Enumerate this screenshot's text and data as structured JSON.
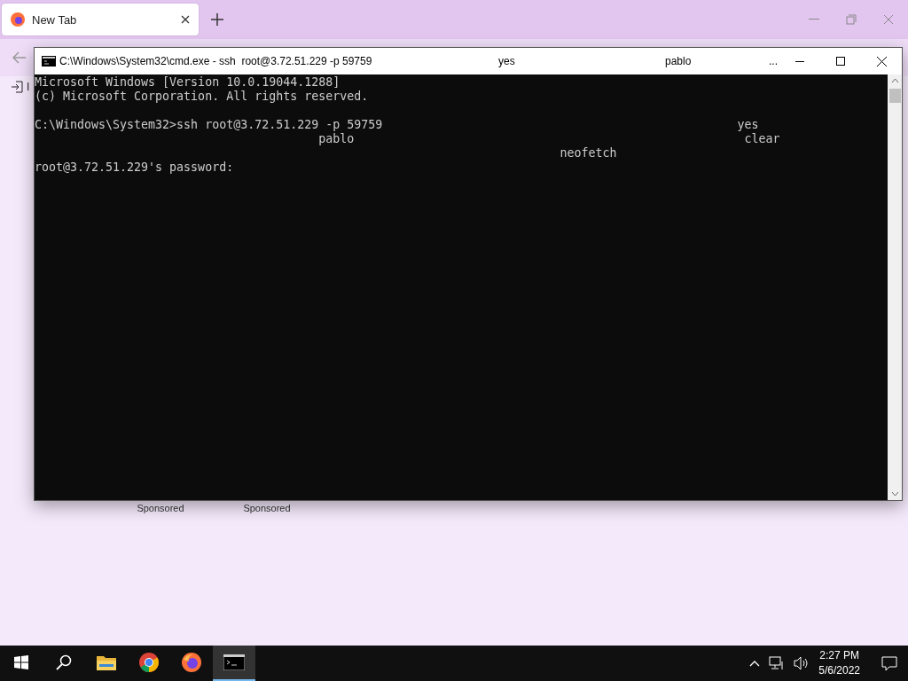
{
  "browser": {
    "tab": {
      "title": "New Tab",
      "selected": true
    },
    "bookmark_partial": "I",
    "shortcuts": [
      {
        "sublabel": "Sponsored"
      },
      {
        "sublabel": "Sponsored"
      }
    ]
  },
  "terminal": {
    "title_parts": [
      "C:\\Windows\\System32\\cmd.exe - ssh  root@3.72.51.229 -p 59759",
      "yes",
      "pablo",
      "..."
    ],
    "lines": [
      {
        "kind": "text",
        "text": "Microsoft Windows [Version 10.0.19044.1288]"
      },
      {
        "kind": "text",
        "text": "(c) Microsoft Corporation. All rights reserved."
      },
      {
        "kind": "blank"
      },
      {
        "kind": "text",
        "text": "C:\\Windows\\System32>ssh root@3.72.51.229 -p 59759                                                  yes"
      },
      {
        "kind": "text",
        "text": "                                        pablo                                                       clear"
      },
      {
        "kind": "text",
        "text": "                                                                          neofetch"
      },
      {
        "kind": "text",
        "text": "root@3.72.51.229's password:"
      }
    ]
  },
  "taskbar": {
    "apps": [
      {
        "kind": "explorer",
        "active": false
      },
      {
        "kind": "chrome",
        "active": false
      },
      {
        "kind": "firefox",
        "active": false
      },
      {
        "kind": "terminal",
        "active": true
      }
    ],
    "time": "2:27 PM",
    "date": "5/6/2022"
  }
}
